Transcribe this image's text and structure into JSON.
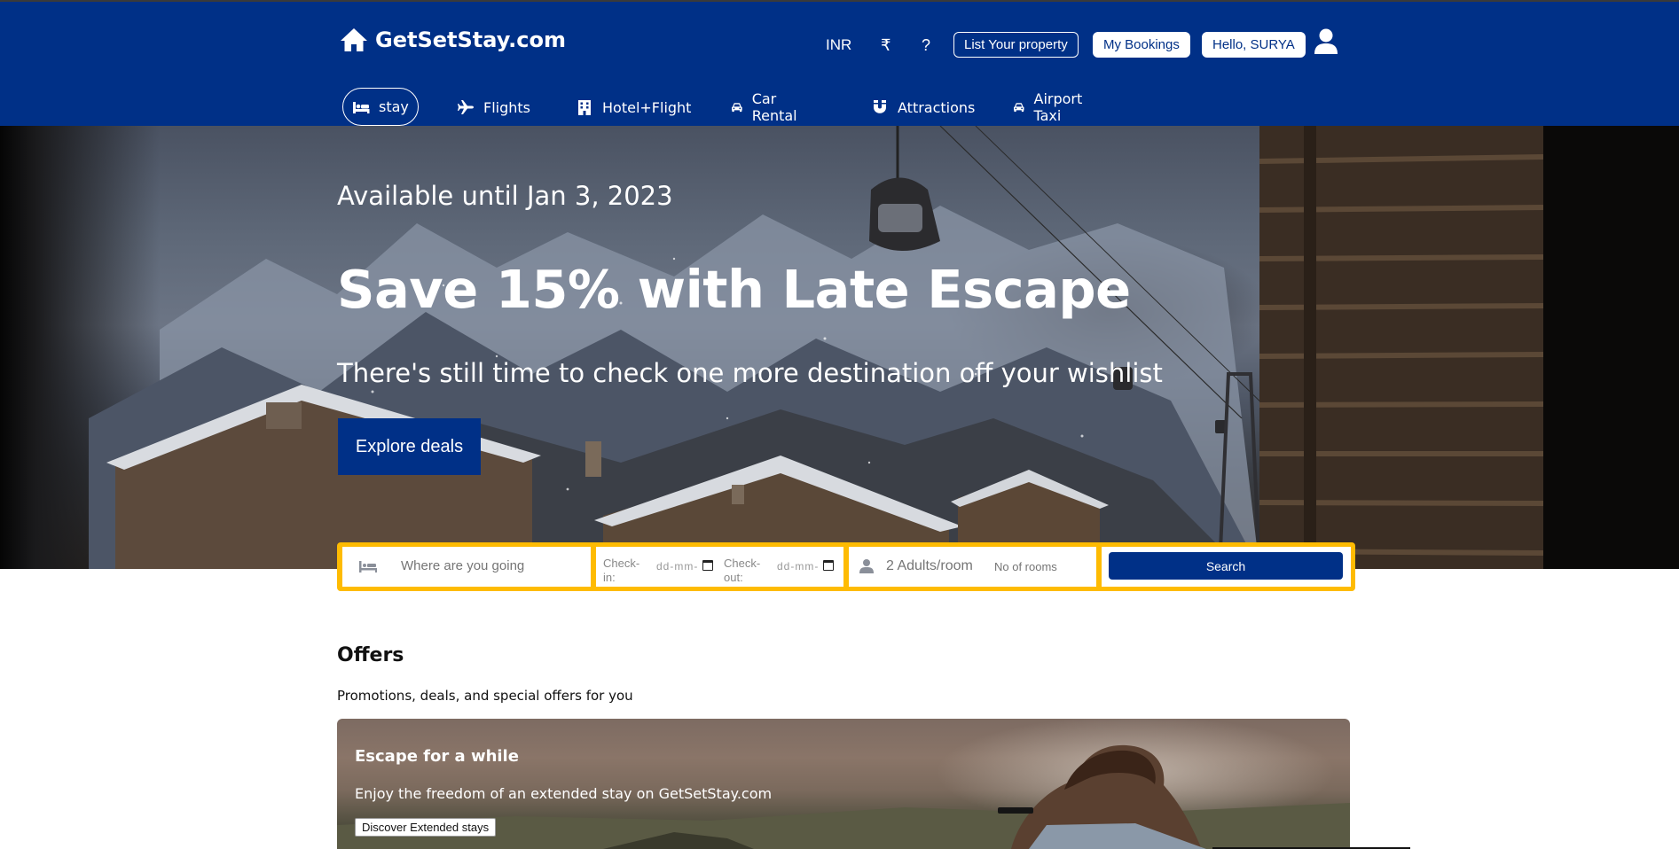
{
  "brand": {
    "name": "GetSetStay.com",
    "icon": "home-icon",
    "primary_color": "#003087",
    "accent_color": "#febb02"
  },
  "topbar": {
    "currency": "INR",
    "currency_symbol": "₹",
    "help": "?",
    "list_property": "List Your property",
    "my_bookings": "My Bookings",
    "greeting": "Hello, SURYA",
    "profile_icon": "user-icon"
  },
  "tabs": [
    {
      "label": "stay",
      "icon": "bed-icon",
      "active": true
    },
    {
      "label": "Flights",
      "icon": "plane-icon"
    },
    {
      "label": "Hotel+Flight",
      "icon": "building-icon"
    },
    {
      "label": "Car Rental",
      "icon": "car-icon"
    },
    {
      "label": "Attractions",
      "icon": "magnet-icon"
    },
    {
      "label": "Airport Taxi",
      "icon": "taxi-icon"
    }
  ],
  "hero": {
    "availability": "Available until Jan 3, 2023",
    "title": "Save 15% with Late Escape",
    "subtitle": "There's still time to check one more destination off your wishlist",
    "cta": "Explore deals"
  },
  "search": {
    "destination_placeholder": "Where are you going",
    "checkin_label": "Check-in:",
    "checkout_label": "Check-out:",
    "date_placeholder": "dd-mm-",
    "guests_placeholder": "2 Adults/room",
    "rooms_placeholder": "No of rooms",
    "button": "Search"
  },
  "offers": {
    "title": "Offers",
    "subtitle": "Promotions, deals, and special offers for you",
    "card": {
      "title": "Escape for a while",
      "text": "Enjoy the freedom of an extended stay on GetSetStay.com",
      "button": "Discover Extended stays"
    }
  }
}
